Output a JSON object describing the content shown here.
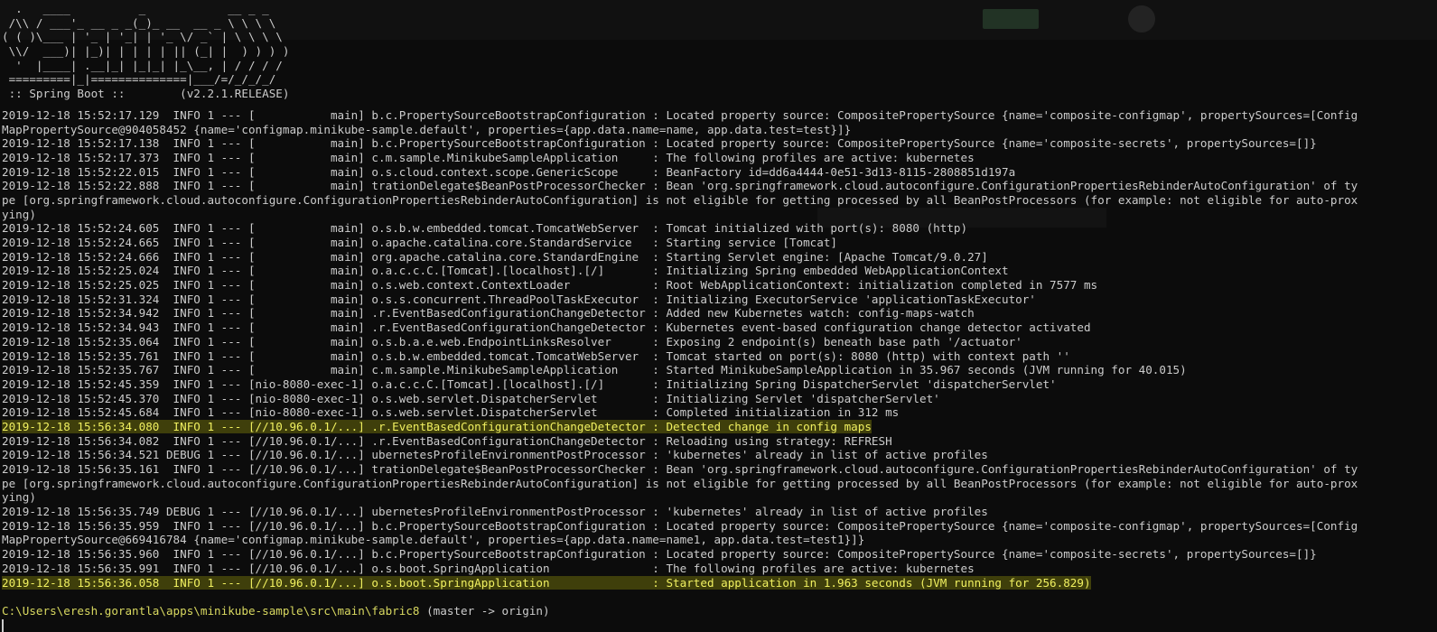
{
  "banner": [
    "  .   ____          _            __ _ _",
    " /\\\\ / ___'_ __ _ _(_)_ __  __ _ \\ \\ \\ \\",
    "( ( )\\___ | '_ | '_| | '_ \\/ _` | \\ \\ \\ \\",
    " \\\\/  ___)| |_)| | | | | || (_| |  ) ) ) )",
    "  '  |____| .__|_| |_|_| |_\\__, | / / / /",
    " =========|_|==============|___/=/_/_/_/",
    " :: Spring Boot ::        (v2.2.1.RELEASE)"
  ],
  "log_lines": [
    {
      "text": "2019-12-18 15:52:17.129  INFO 1 --- [           main] b.c.PropertySourceBootstrapConfiguration : Located property source: CompositePropertySource {name='composite-configmap', propertySources=[Config",
      "highlight": false
    },
    {
      "text": "MapPropertySource@904058452 {name='configmap.minikube-sample.default', properties={app.data.name=name, app.data.test=test}]}",
      "highlight": false
    },
    {
      "text": "2019-12-18 15:52:17.138  INFO 1 --- [           main] b.c.PropertySourceBootstrapConfiguration : Located property source: CompositePropertySource {name='composite-secrets', propertySources=[]}",
      "highlight": false
    },
    {
      "text": "2019-12-18 15:52:17.373  INFO 1 --- [           main] c.m.sample.MinikubeSampleApplication     : The following profiles are active: kubernetes",
      "highlight": false
    },
    {
      "text": "2019-12-18 15:52:22.015  INFO 1 --- [           main] o.s.cloud.context.scope.GenericScope     : BeanFactory id=dd6a4444-0e51-3d13-8115-2808851d197a",
      "highlight": false
    },
    {
      "text": "2019-12-18 15:52:22.888  INFO 1 --- [           main] trationDelegate$BeanPostProcessorChecker : Bean 'org.springframework.cloud.autoconfigure.ConfigurationPropertiesRebinderAutoConfiguration' of ty",
      "highlight": false
    },
    {
      "text": "pe [org.springframework.cloud.autoconfigure.ConfigurationPropertiesRebinderAutoConfiguration] is not eligible for getting processed by all BeanPostProcessors (for example: not eligible for auto-prox",
      "highlight": false
    },
    {
      "text": "ying)",
      "highlight": false
    },
    {
      "text": "2019-12-18 15:52:24.605  INFO 1 --- [           main] o.s.b.w.embedded.tomcat.TomcatWebServer  : Tomcat initialized with port(s): 8080 (http)",
      "highlight": false
    },
    {
      "text": "2019-12-18 15:52:24.665  INFO 1 --- [           main] o.apache.catalina.core.StandardService   : Starting service [Tomcat]",
      "highlight": false
    },
    {
      "text": "2019-12-18 15:52:24.666  INFO 1 --- [           main] org.apache.catalina.core.StandardEngine  : Starting Servlet engine: [Apache Tomcat/9.0.27]",
      "highlight": false
    },
    {
      "text": "2019-12-18 15:52:25.024  INFO 1 --- [           main] o.a.c.c.C.[Tomcat].[localhost].[/]       : Initializing Spring embedded WebApplicationContext",
      "highlight": false
    },
    {
      "text": "2019-12-18 15:52:25.025  INFO 1 --- [           main] o.s.web.context.ContextLoader            : Root WebApplicationContext: initialization completed in 7577 ms",
      "highlight": false
    },
    {
      "text": "2019-12-18 15:52:31.324  INFO 1 --- [           main] o.s.s.concurrent.ThreadPoolTaskExecutor  : Initializing ExecutorService 'applicationTaskExecutor'",
      "highlight": false
    },
    {
      "text": "2019-12-18 15:52:34.942  INFO 1 --- [           main] .r.EventBasedConfigurationChangeDetector : Added new Kubernetes watch: config-maps-watch",
      "highlight": false
    },
    {
      "text": "2019-12-18 15:52:34.943  INFO 1 --- [           main] .r.EventBasedConfigurationChangeDetector : Kubernetes event-based configuration change detector activated",
      "highlight": false
    },
    {
      "text": "2019-12-18 15:52:35.064  INFO 1 --- [           main] o.s.b.a.e.web.EndpointLinksResolver      : Exposing 2 endpoint(s) beneath base path '/actuator'",
      "highlight": false
    },
    {
      "text": "2019-12-18 15:52:35.761  INFO 1 --- [           main] o.s.b.w.embedded.tomcat.TomcatWebServer  : Tomcat started on port(s): 8080 (http) with context path ''",
      "highlight": false
    },
    {
      "text": "2019-12-18 15:52:35.767  INFO 1 --- [           main] c.m.sample.MinikubeSampleApplication     : Started MinikubeSampleApplication in 35.967 seconds (JVM running for 40.015)",
      "highlight": false
    },
    {
      "text": "2019-12-18 15:52:45.359  INFO 1 --- [nio-8080-exec-1] o.a.c.c.C.[Tomcat].[localhost].[/]       : Initializing Spring DispatcherServlet 'dispatcherServlet'",
      "highlight": false
    },
    {
      "text": "2019-12-18 15:52:45.370  INFO 1 --- [nio-8080-exec-1] o.s.web.servlet.DispatcherServlet        : Initializing Servlet 'dispatcherServlet'",
      "highlight": false
    },
    {
      "text": "2019-12-18 15:52:45.684  INFO 1 --- [nio-8080-exec-1] o.s.web.servlet.DispatcherServlet        : Completed initialization in 312 ms",
      "highlight": false
    },
    {
      "text": "2019-12-18 15:56:34.080  INFO 1 --- [//10.96.0.1/...] .r.EventBasedConfigurationChangeDetector : Detected change in config maps",
      "highlight": true
    },
    {
      "text": "2019-12-18 15:56:34.082  INFO 1 --- [//10.96.0.1/...] .r.EventBasedConfigurationChangeDetector : Reloading using strategy: REFRESH",
      "highlight": false
    },
    {
      "text": "2019-12-18 15:56:34.521 DEBUG 1 --- [//10.96.0.1/...] ubernetesProfileEnvironmentPostProcessor : 'kubernetes' already in list of active profiles",
      "highlight": false
    },
    {
      "text": "2019-12-18 15:56:35.161  INFO 1 --- [//10.96.0.1/...] trationDelegate$BeanPostProcessorChecker : Bean 'org.springframework.cloud.autoconfigure.ConfigurationPropertiesRebinderAutoConfiguration' of ty",
      "highlight": false
    },
    {
      "text": "pe [org.springframework.cloud.autoconfigure.ConfigurationPropertiesRebinderAutoConfiguration] is not eligible for getting processed by all BeanPostProcessors (for example: not eligible for auto-prox",
      "highlight": false
    },
    {
      "text": "ying)",
      "highlight": false
    },
    {
      "text": "2019-12-18 15:56:35.749 DEBUG 1 --- [//10.96.0.1/...] ubernetesProfileEnvironmentPostProcessor : 'kubernetes' already in list of active profiles",
      "highlight": false
    },
    {
      "text": "2019-12-18 15:56:35.959  INFO 1 --- [//10.96.0.1/...] b.c.PropertySourceBootstrapConfiguration : Located property source: CompositePropertySource {name='composite-configmap', propertySources=[Config",
      "highlight": false
    },
    {
      "text": "MapPropertySource@669416784 {name='configmap.minikube-sample.default', properties={app.data.name=name1, app.data.test=test1}]}",
      "highlight": false
    },
    {
      "text": "2019-12-18 15:56:35.960  INFO 1 --- [//10.96.0.1/...] b.c.PropertySourceBootstrapConfiguration : Located property source: CompositePropertySource {name='composite-secrets', propertySources=[]}",
      "highlight": false
    },
    {
      "text": "2019-12-18 15:56:35.991  INFO 1 --- [//10.96.0.1/...] o.s.boot.SpringApplication               : The following profiles are active: kubernetes",
      "highlight": false
    },
    {
      "text": "2019-12-18 15:56:36.058  INFO 1 --- [//10.96.0.1/...] o.s.boot.SpringApplication               : Started application in 1.963 seconds (JVM running for 256.829)",
      "highlight": true
    }
  ],
  "prompt": {
    "path": "C:\\Users\\eresh.gorantla\\apps\\minikube-sample\\src\\main\\fabric8",
    "branch": " (master -> origin)"
  },
  "colors": {
    "background": "#0c0c0c",
    "foreground": "#cccccc",
    "highlight_background": "#3f3f0b",
    "highlight_foreground": "#f0f060",
    "prompt_path": "#d8d860"
  }
}
